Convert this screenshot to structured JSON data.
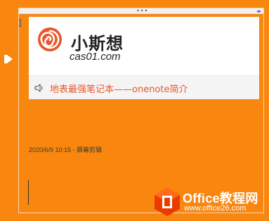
{
  "colors": {
    "page_background": "#F8860F",
    "logo_orange": "#E8562A",
    "title_link": "#E8562A"
  },
  "container": {
    "grip_icon": "grip-dots-icon",
    "resize_icon": "resize-arrows-icon"
  },
  "clip": {
    "brand_name": "小斯想",
    "brand_domain": "cas01.com",
    "speaker_icon": "speaker-icon",
    "title": "地表最强笔记本——onenote简介"
  },
  "meta": {
    "timestamp_source": "2020/6/9 10:15 - 屏幕剪辑"
  },
  "watermark": {
    "line1": "Office教程网",
    "line2": "www.office26.com"
  }
}
